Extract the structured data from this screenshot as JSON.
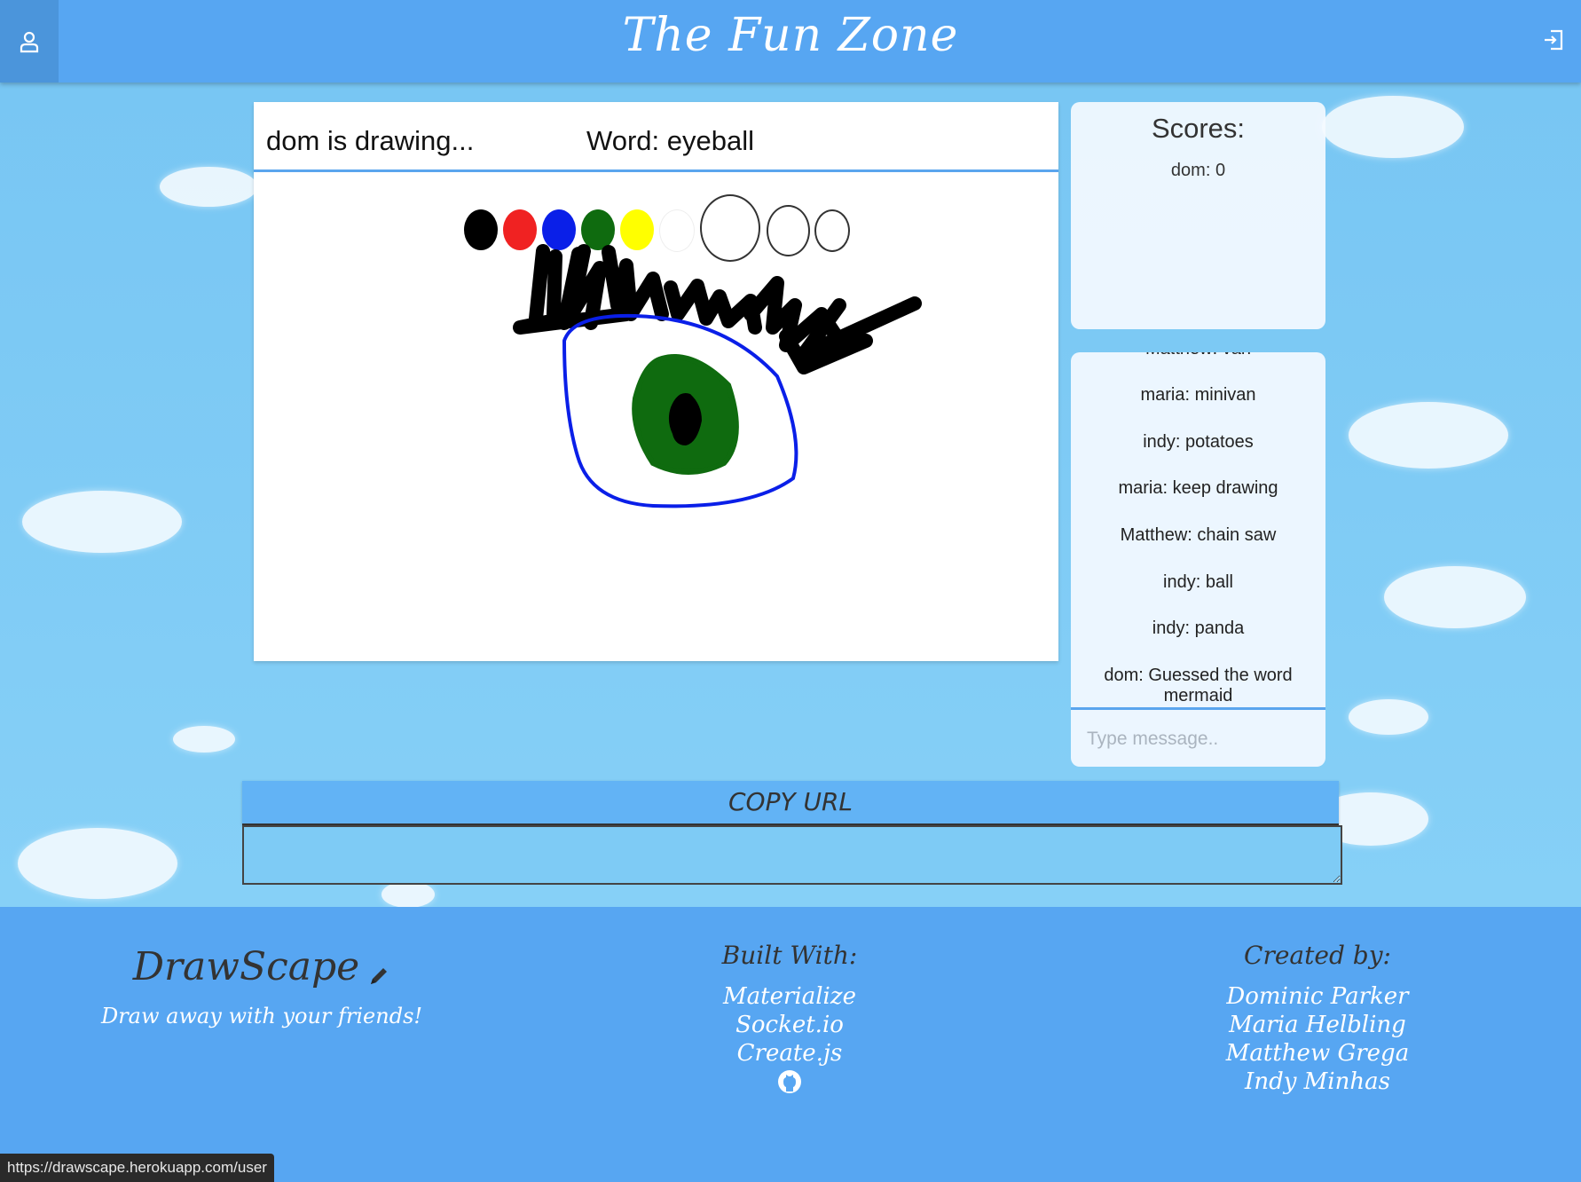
{
  "navbar": {
    "title": "The Fun Zone",
    "user_icon": "user-icon",
    "logout_icon": "logout-icon"
  },
  "game": {
    "drawing_status": "dom is drawing...",
    "word_label": "Word: eyeball",
    "palette": {
      "colors": [
        "#000000",
        "#f02222",
        "#0a1fe8",
        "#0f6b0f",
        "#ffff00",
        "#ffffff"
      ],
      "brush_sizes": [
        "large",
        "medium",
        "small"
      ]
    }
  },
  "scores": {
    "title": "Scores:",
    "items": [
      "dom: 0"
    ]
  },
  "chat": {
    "messages": [
      "Matthew: van",
      "maria: minivan",
      "indy: potatoes",
      "maria: keep drawing",
      "Matthew: chain saw",
      "indy: ball",
      "indy: panda",
      "dom: Guessed the word mermaid"
    ],
    "input_placeholder": "Type message.."
  },
  "copy_url": {
    "button_label": "COPY URL"
  },
  "footer": {
    "brand": "DrawScape",
    "brand_icon": "pencil-icon",
    "tagline": "Draw away with your friends!",
    "built_with_heading": "Built With:",
    "built_with": [
      "Materialize",
      "Socket.io",
      "Create.js"
    ],
    "github_icon": "github-icon",
    "created_by_heading": "Created by:",
    "creators": [
      "Dominic Parker",
      "Maria Helbling",
      "Matthew Grega",
      "Indy Minhas"
    ]
  },
  "status_bar": {
    "url": "https://drawscape.herokuapp.com/user"
  }
}
